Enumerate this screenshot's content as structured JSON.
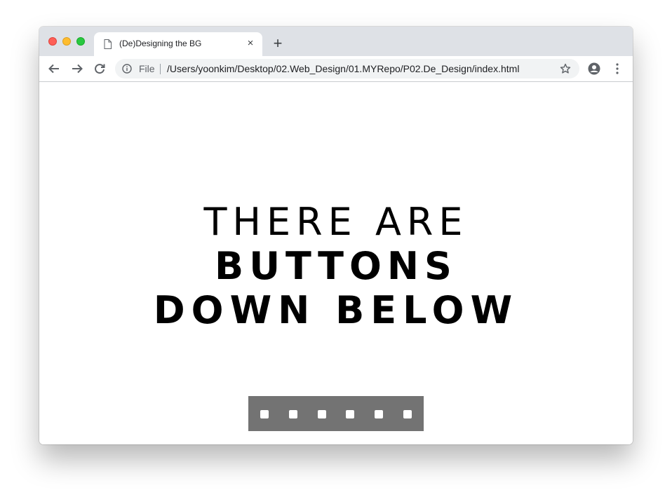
{
  "browser": {
    "tab": {
      "title": "(De)Designing the BG",
      "close_symbol": "×",
      "icon": "document-icon"
    },
    "new_tab_symbol": "+",
    "omnibox": {
      "scheme_label": "File",
      "url": "/Users/yoonkim/Desktop/02.Web_Design/01.MYRepo/P02.De_Design/index.html"
    },
    "icons": [
      "back-arrow-icon",
      "forward-arrow-icon",
      "reload-icon",
      "info-icon",
      "star-icon",
      "profile-icon",
      "kebab-menu-icon"
    ]
  },
  "page": {
    "headline": {
      "line1": "THERE ARE",
      "line2": "BUTTONS",
      "line3": "DOWN BELOW"
    },
    "button_bar": {
      "background": "#737373",
      "button_count": 6
    }
  }
}
